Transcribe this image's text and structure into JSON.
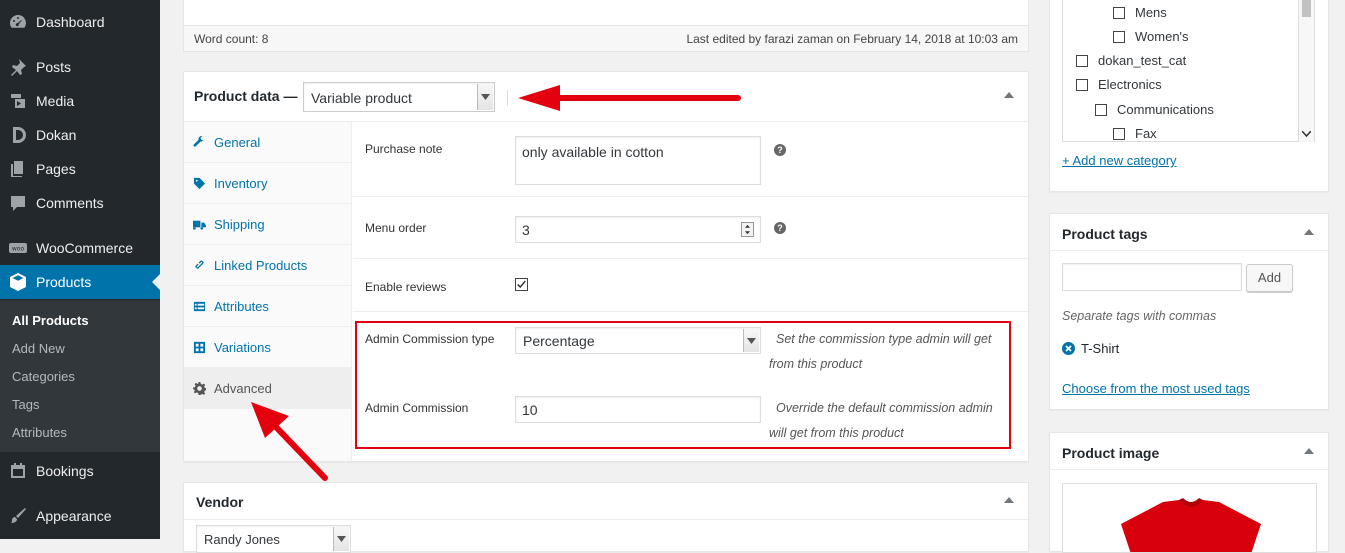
{
  "sidebar": {
    "items": [
      {
        "label": "Dashboard",
        "icon": "dashboard-icon"
      },
      {
        "label": "Posts",
        "icon": "pushpin-icon"
      },
      {
        "label": "Media",
        "icon": "media-icon"
      },
      {
        "label": "Dokan",
        "icon": "dokan-icon"
      },
      {
        "label": "Pages",
        "icon": "pages-icon"
      },
      {
        "label": "Comments",
        "icon": "comments-icon"
      },
      {
        "label": "WooCommerce",
        "icon": "woocommerce-icon"
      },
      {
        "label": "Products",
        "icon": "products-icon"
      },
      {
        "label": "Bookings",
        "icon": "calendar-icon"
      },
      {
        "label": "Appearance",
        "icon": "paintbrush-icon"
      }
    ],
    "submenu": [
      "All Products",
      "Add New",
      "Categories",
      "Tags",
      "Attributes"
    ]
  },
  "editor": {
    "word_count": "Word count: 8",
    "last_edited": "Last edited by farazi zaman on February 14, 2018 at 10:03 am"
  },
  "product_data": {
    "title": "Product data —",
    "product_type": "Variable product",
    "tabs": [
      "General",
      "Inventory",
      "Shipping",
      "Linked Products",
      "Attributes",
      "Variations",
      "Advanced"
    ],
    "active_tab": "Advanced",
    "fields": {
      "purchase_note_label": "Purchase note",
      "purchase_note_value": "only available in cotton",
      "menu_order_label": "Menu order",
      "menu_order_value": "3",
      "enable_reviews_label": "Enable reviews",
      "enable_reviews_checked": true,
      "commission_type_label": "Admin Commission type",
      "commission_type_value": "Percentage",
      "commission_type_desc_1": "Set the commission type admin will get",
      "commission_type_desc_2": "from this product",
      "commission_label": "Admin Commission",
      "commission_value": "10",
      "commission_desc_1": "Override the default commission admin",
      "commission_desc_2": "will get from this product"
    },
    "help_tip": "?"
  },
  "vendor": {
    "title": "Vendor",
    "selected": "Randy Jones"
  },
  "categories": {
    "items": [
      "Mens",
      "Women's",
      "dokan_test_cat",
      "Electronics",
      "Communications",
      "Fax"
    ],
    "add_new": "+ Add new category"
  },
  "tags": {
    "title": "Product tags",
    "add_button": "Add",
    "hint": "Separate tags with commas",
    "tag": "T-Shirt",
    "choose_link": "Choose from the most used tags"
  },
  "product_image": {
    "title": "Product image"
  },
  "colors": {
    "admin_bar": "#23282d",
    "active_menu": "#0073aa",
    "highlight": "#e3000f",
    "link": "#0073aa"
  }
}
